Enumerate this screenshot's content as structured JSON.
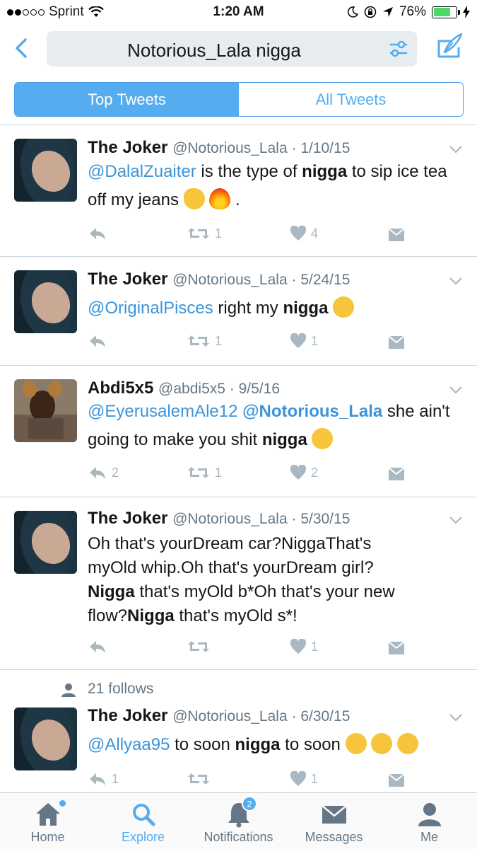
{
  "status_bar": {
    "carrier": "Sprint",
    "time": "1:20 AM",
    "battery": "76%",
    "battery_level": 0.76
  },
  "search": {
    "query": "Notorious_Lala nigga"
  },
  "segments": {
    "top": "Top Tweets",
    "all": "All Tweets"
  },
  "tweets": [
    {
      "name": "The Joker",
      "handle": "@Notorious_Lala",
      "date": "1/10/15",
      "mention": "@DalalZuaiter",
      "text_a": " is the type of ",
      "bold": "nigga",
      "text_b": " to sip ice tea off my jeans",
      "text_c": " .",
      "emoji": [
        "ok-hand",
        "fire"
      ],
      "reply_count": "",
      "retweet_count": "1",
      "like_count": "4"
    },
    {
      "name": "The Joker",
      "handle": "@Notorious_Lala",
      "date": "5/24/15",
      "mention": "@OriginalPisces",
      "text_a": " right my ",
      "bold": "nigga",
      "emoji": [
        "unamused-face"
      ],
      "reply_count": "",
      "retweet_count": "1",
      "like_count": "1"
    },
    {
      "name": "Abdi5x5",
      "handle": "@abdi5x5",
      "date": "9/5/16",
      "mention": "@EyerusalemAle12",
      "mention2": "@Notorious_Lala",
      "text_a": "  she ain't going to make you shit ",
      "bold": "nigga",
      "emoji": [
        "joy-face"
      ],
      "reply_count": "2",
      "retweet_count": "1",
      "like_count": "2"
    },
    {
      "name": "The Joker",
      "handle": "@Notorious_Lala",
      "date": "5/30/15",
      "line1": "Oh that's yourDream car?NiggaThat's",
      "line2": "myOld whip.Oh that's yourDream girl?",
      "bold1": "Nigga",
      "line3": " that's myOld b*Oh that's your new",
      "line4a": "flow?",
      "bold2": "Nigga",
      "line4b": " that's myOld s*!",
      "reply_count": "",
      "retweet_count": "",
      "like_count": "1"
    },
    {
      "follows_label": "21 follows",
      "name": "The Joker",
      "handle": "@Notorious_Lala",
      "date": "6/30/15",
      "mention": "@Allyaa95",
      "text_a": " to soon ",
      "bold": "nigga",
      "text_b": " to soon ",
      "emoji": [
        "steam-face",
        "flushed-face",
        "grin-face"
      ],
      "reply_count": "1",
      "retweet_count": "",
      "like_count": "1"
    }
  ],
  "tabbar": {
    "home": "Home",
    "explore": "Explore",
    "notifications": "Notifications",
    "notifications_badge": "2",
    "messages": "Messages",
    "me": "Me"
  },
  "colors": {
    "accent": "#55acee",
    "mention": "#3b94d9",
    "muted": "#657786",
    "icon_gray": "#aab8c2"
  }
}
